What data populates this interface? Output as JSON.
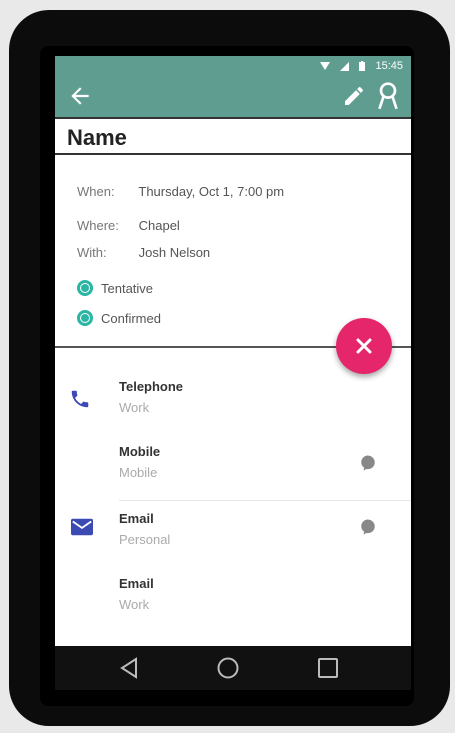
{
  "status_bar": {
    "time": "15:45",
    "wifi_icon": "wifi-icon",
    "signal_icon": "signal-icon",
    "battery_icon": "battery-icon"
  },
  "app_bar": {
    "back_icon": "arrow-left-icon",
    "edit_icon": "pencil-icon",
    "award_icon": "award-icon",
    "color": "#5f9d91"
  },
  "title": "Name",
  "details": {
    "when_label": "When:",
    "when_value": "Thursday, Oct 1, 7:00 pm",
    "where_label": "Where:",
    "where_value": "Chapel",
    "with_label": "With:",
    "with_value": "Josh Nelson"
  },
  "status_options": [
    {
      "label": "Tentative",
      "selected": true
    },
    {
      "label": "Confirmed",
      "selected": true
    }
  ],
  "fab": {
    "icon": "close-icon",
    "color": "#e5266a"
  },
  "contacts": [
    {
      "main": "Telephone",
      "sub": "Work"
    },
    {
      "main": "Mobile",
      "sub": "Mobile"
    },
    {
      "main": "Email",
      "sub": "Personal"
    },
    {
      "main": "Email",
      "sub": "Work"
    }
  ],
  "nav_bar": {
    "back_icon": "triangle-back-icon",
    "home_icon": "circle-home-icon",
    "recents_icon": "square-recents-icon"
  }
}
